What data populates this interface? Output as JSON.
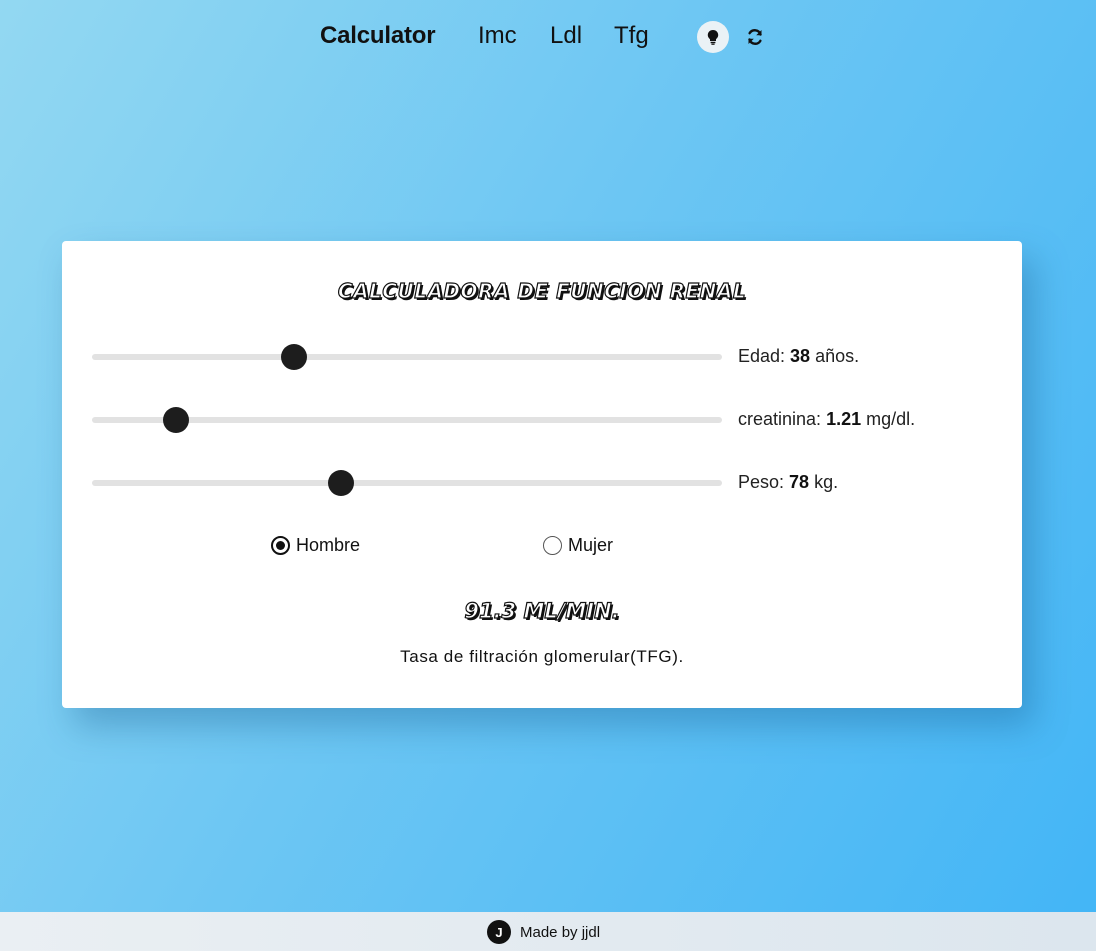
{
  "nav": {
    "brand": "Calculator",
    "links": [
      "Imc",
      "Ldl",
      "Tfg"
    ],
    "theme_icon": "lightbulb-icon",
    "refresh_icon": "refresh-icon"
  },
  "card": {
    "title": "Calculadora de funcion renal",
    "sliders": {
      "edad": {
        "label": "Edad: ",
        "value": "38",
        "unit": " años.",
        "fraction": 0.32
      },
      "creatinina": {
        "label": "creatinina: ",
        "value": "1.21",
        "unit": " mg/dl.",
        "fraction": 0.134
      },
      "peso": {
        "label": "Peso: ",
        "value": "78",
        "unit": " kg.",
        "fraction": 0.395
      }
    },
    "sex": {
      "options": [
        "Hombre",
        "Mujer"
      ],
      "selected": "Hombre"
    },
    "result": "91.3 ml/min.",
    "result_desc": "Tasa de filtración glomerular(TFG)."
  },
  "footer": {
    "logo": "J",
    "text": "Made by jjdl"
  }
}
